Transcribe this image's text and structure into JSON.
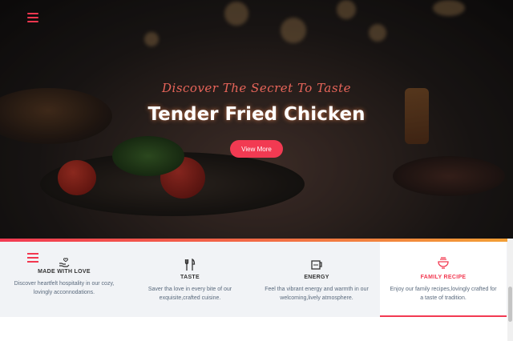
{
  "hero": {
    "subtitle": "Discover The Secret To Taste",
    "title": "Tender Fried Chicken",
    "button_label": "View More"
  },
  "features": [
    {
      "icon": "hand-heart-icon",
      "title": "MADE WITH LOVE",
      "desc": "Discover heartfelt hospitality in our cozy, lovingly acconnodations."
    },
    {
      "icon": "fork-knife-icon",
      "title": "TASTE",
      "desc": "Saver tha love in every bite of our exquisite,crafted cuisine."
    },
    {
      "icon": "coffee-cup-icon",
      "title": "ENERGY",
      "desc": "Feel tha vibrant energy and warmth in our welcoming,lively atmosphere."
    },
    {
      "icon": "bowl-icon",
      "title": "FAMILY RECIPE",
      "desc": "Enjoy our family recipes,lovingly crafted for a taste of tradition."
    }
  ],
  "colors": {
    "accent": "#f23a52",
    "feature_bg": "#f1f3f6",
    "desc_text": "#5a6a7d"
  }
}
